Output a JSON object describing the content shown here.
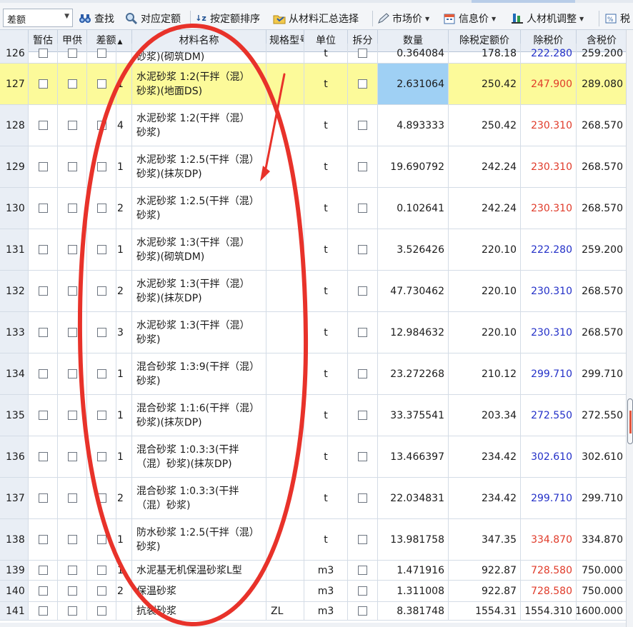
{
  "toolbar": {
    "dropdown_value": "差额",
    "find_label": "查找",
    "match_label": "对应定额",
    "sort_label": "按定额排序",
    "summary_label": "从材料汇总选择",
    "market_label": "市场价",
    "info_label": "信息价",
    "adjust_label": "人材机调整",
    "tax_label": "税"
  },
  "columns": {
    "provisional": "暂估",
    "owner_supply": "甲供",
    "diff": "差额",
    "name": "材料名称",
    "spec": "规格型号",
    "unit": "单位",
    "split": "拆分",
    "qty": "数量",
    "pretax_quota": "除税定额价",
    "pretax_price": "除税价",
    "tax_price": "含税价"
  },
  "rows": [
    {
      "num": "126",
      "code": "",
      "name1": "砂浆)(砌筑DM)",
      "name2": "",
      "spec": "",
      "unit": "t",
      "qty": "0.364084",
      "quota": "178.18",
      "pretax": "222.280",
      "pretax_color": "blue",
      "tax": "259.200",
      "partial": true
    },
    {
      "num": "127",
      "code": "1",
      "name1": "水泥砂浆 1:2(干拌（混）",
      "name2": "砂浆)(地面DS)",
      "spec": "",
      "unit": "t",
      "qty": "2.631064",
      "quota": "250.42",
      "pretax": "247.900",
      "pretax_color": "red",
      "tax": "289.080",
      "highlight": true
    },
    {
      "num": "128",
      "code": "4",
      "name1": "水泥砂浆 1:2(干拌（混）",
      "name2": "砂浆)",
      "spec": "",
      "unit": "t",
      "qty": "4.893333",
      "quota": "250.42",
      "pretax": "230.310",
      "pretax_color": "red",
      "tax": "268.570"
    },
    {
      "num": "129",
      "code": "1",
      "name1": "水泥砂浆 1:2.5(干拌（混）",
      "name2": "砂浆)(抹灰DP)",
      "spec": "",
      "unit": "t",
      "qty": "19.690792",
      "quota": "242.24",
      "pretax": "230.310",
      "pretax_color": "red",
      "tax": "268.570"
    },
    {
      "num": "130",
      "code": "2",
      "name1": "水泥砂浆 1:2.5(干拌（混）",
      "name2": "砂浆)",
      "spec": "",
      "unit": "t",
      "qty": "0.102641",
      "quota": "242.24",
      "pretax": "230.310",
      "pretax_color": "red",
      "tax": "268.570"
    },
    {
      "num": "131",
      "code": "1",
      "name1": "水泥砂浆 1:3(干拌（混）",
      "name2": "砂浆)(砌筑DM)",
      "spec": "",
      "unit": "t",
      "qty": "3.526426",
      "quota": "220.10",
      "pretax": "222.280",
      "pretax_color": "blue",
      "tax": "259.200"
    },
    {
      "num": "132",
      "code": "2",
      "name1": "水泥砂浆 1:3(干拌（混）",
      "name2": "砂浆)(抹灰DP)",
      "spec": "",
      "unit": "t",
      "qty": "47.730462",
      "quota": "220.10",
      "pretax": "230.310",
      "pretax_color": "blue",
      "tax": "268.570"
    },
    {
      "num": "133",
      "code": "3",
      "name1": "水泥砂浆 1:3(干拌（混）",
      "name2": "砂浆)",
      "spec": "",
      "unit": "t",
      "qty": "12.984632",
      "quota": "220.10",
      "pretax": "230.310",
      "pretax_color": "blue",
      "tax": "268.570"
    },
    {
      "num": "134",
      "code": "1",
      "name1": "混合砂浆 1:3:9(干拌（混）",
      "name2": "砂浆)",
      "spec": "",
      "unit": "t",
      "qty": "23.272268",
      "quota": "210.12",
      "pretax": "299.710",
      "pretax_color": "blue",
      "tax": "299.710"
    },
    {
      "num": "135",
      "code": "1",
      "name1": "混合砂浆 1:1:6(干拌（混）",
      "name2": "砂浆)(抹灰DP)",
      "spec": "",
      "unit": "t",
      "qty": "33.375541",
      "quota": "203.34",
      "pretax": "272.550",
      "pretax_color": "blue",
      "tax": "272.550"
    },
    {
      "num": "136",
      "code": "1",
      "name1": "混合砂浆 1:0.3:3(干拌",
      "name2": "（混）砂浆)(抹灰DP)",
      "spec": "",
      "unit": "t",
      "qty": "13.466397",
      "quota": "234.42",
      "pretax": "302.610",
      "pretax_color": "blue",
      "tax": "302.610"
    },
    {
      "num": "137",
      "code": "2",
      "name1": "混合砂浆 1:0.3:3(干拌",
      "name2": "（混）砂浆)",
      "spec": "",
      "unit": "t",
      "qty": "22.034831",
      "quota": "234.42",
      "pretax": "299.710",
      "pretax_color": "blue",
      "tax": "299.710"
    },
    {
      "num": "138",
      "code": "1",
      "name1": "防水砂浆 1:2.5(干拌（混）",
      "name2": "砂浆)",
      "spec": "",
      "unit": "t",
      "qty": "13.981758",
      "quota": "347.35",
      "pretax": "334.870",
      "pretax_color": "red",
      "tax": "334.870"
    },
    {
      "num": "139",
      "code": "1",
      "name1": "水泥基无机保温砂浆L型",
      "name2": "",
      "spec": "",
      "unit": "m3",
      "qty": "1.471916",
      "quota": "922.87",
      "pretax": "728.580",
      "pretax_color": "red",
      "tax": "750.000"
    },
    {
      "num": "140",
      "code": "2",
      "name1": "保温砂浆",
      "name2": "",
      "spec": "",
      "unit": "m3",
      "qty": "1.311008",
      "quota": "922.87",
      "pretax": "728.580",
      "pretax_color": "red",
      "tax": "750.000"
    },
    {
      "num": "141",
      "code": "",
      "name1": "抗裂砂浆",
      "name2": "",
      "spec": "ZL",
      "unit": "m3",
      "qty": "8.381748",
      "quota": "1554.31",
      "pretax": "1554.310",
      "pretax_color": "black",
      "tax": "1600.000"
    }
  ],
  "colors": {
    "highlight_row": "#fcfa9a",
    "selected_cell": "#9fd0f4",
    "annotation": "#e8322a",
    "price_red": "#e03b2a",
    "price_blue": "#2330c8"
  }
}
